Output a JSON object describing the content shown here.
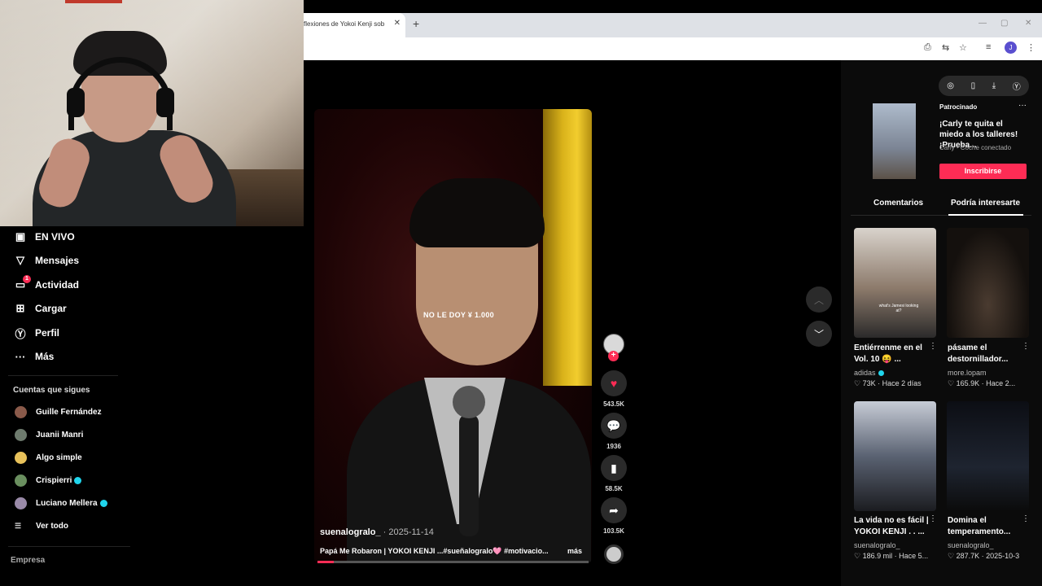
{
  "browser": {
    "tab_title": "flexiones de Yokoi Kenji sob",
    "tab_close": "✕",
    "new_tab": "+",
    "profile_initial": "J",
    "window_controls": [
      "—",
      "▢",
      "✕"
    ]
  },
  "sidebar": {
    "nav": [
      {
        "label": "EN VIVO",
        "icon": "live-tv-icon",
        "glyph": "▣"
      },
      {
        "label": "Mensajes",
        "icon": "send-icon",
        "glyph": "▽"
      },
      {
        "label": "Actividad",
        "icon": "activity-icon",
        "glyph": "▭",
        "badge": "1"
      },
      {
        "label": "Cargar",
        "icon": "upload-icon",
        "glyph": "⊞"
      },
      {
        "label": "Perfil",
        "icon": "profile-icon",
        "glyph": "Ⓨ"
      },
      {
        "label": "Más",
        "icon": "more-icon",
        "glyph": "···"
      }
    ],
    "following_title": "Cuentas que sigues",
    "following": [
      {
        "name": "Guille Fernández",
        "verified": false,
        "color": "#8a5a4a"
      },
      {
        "name": "Juanii Manri",
        "verified": false,
        "color": "#6e7b6e"
      },
      {
        "name": "Algo simple",
        "verified": false,
        "color": "#e8c15a"
      },
      {
        "name": "Crispierri",
        "verified": true,
        "color": "#6a8f5f"
      },
      {
        "name": "Luciano Mellera",
        "verified": true,
        "color": "#9a8aa8"
      }
    ],
    "see_all": "Ver todo",
    "company": "Empresa"
  },
  "video": {
    "caption_overlay": "NO LE DOY ¥ 1.000",
    "progress": 0.06,
    "author": "suenalogralo_",
    "date": "· 2025-11-14",
    "description": "Papá Me Robaron | YOKOI KENJI ...#sueñalogralo🩷 #motivacio...",
    "more": "más"
  },
  "actions": {
    "likes": "543.5K",
    "comments": "1936",
    "saves": "58.5K",
    "shares": "103.5K"
  },
  "right_panel": {
    "ad": {
      "label": "Patrocinado",
      "title": "¡Carly te quita el miedo a los talleres! ¡Prueba...",
      "subtitle": "Carly - Coche conectado",
      "button": "Inscribirse"
    },
    "tabs": [
      "Comentarios",
      "Podría interesarte"
    ],
    "cards": [
      {
        "title": "Entiérrenme en el Vol. 10 😝 ...",
        "author": "adidas",
        "verified": true,
        "likes": "73K",
        "time": "Hace 2 días",
        "overlay": "what's Jamesi looking at?"
      },
      {
        "title": "pásame el destornillador...",
        "author": "more.lopam",
        "verified": false,
        "likes": "165.9K",
        "time": "Hace 2...",
        "overlay": ""
      },
      {
        "title": "La vida no es fácil | YOKOI KENJI . . ...",
        "author": "suenalogralo_",
        "verified": false,
        "likes": "186.9 mil",
        "time": "Hace 5...",
        "overlay": ""
      },
      {
        "title": "Domina el temperamento...",
        "author": "suenalogralo_",
        "verified": false,
        "likes": "287.7K",
        "time": "2025-10-3",
        "overlay": ""
      }
    ]
  },
  "colors": {
    "accent": "#fe2c55",
    "verified": "#20d5ec"
  }
}
